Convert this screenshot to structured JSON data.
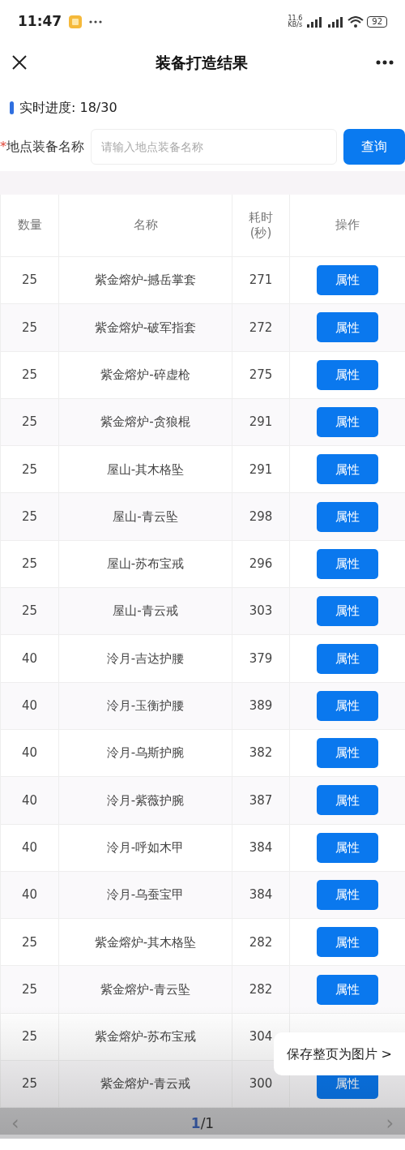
{
  "status_bar": {
    "time": "11:47",
    "speed": "11.6\nKB/s",
    "battery": "92"
  },
  "header": {
    "title": "装备打造结果"
  },
  "progress": {
    "label": "实时进度: 18/30"
  },
  "search": {
    "required_mark": "*",
    "label": "地点装备名称",
    "placeholder": "请输入地点装备名称",
    "button": "查询"
  },
  "table": {
    "columns": [
      "数量",
      "名称",
      "耗时\n(秒)",
      "操作"
    ],
    "rows": [
      {
        "qty": "25",
        "name": "紫金熔炉-撼岳掌套",
        "time": "271",
        "action": "属性"
      },
      {
        "qty": "25",
        "name": "紫金熔炉-破军指套",
        "time": "272",
        "action": "属性"
      },
      {
        "qty": "25",
        "name": "紫金熔炉-碎虚枪",
        "time": "275",
        "action": "属性"
      },
      {
        "qty": "25",
        "name": "紫金熔炉-贪狼棍",
        "time": "291",
        "action": "属性"
      },
      {
        "qty": "25",
        "name": "屋山-其木格坠",
        "time": "291",
        "action": "属性"
      },
      {
        "qty": "25",
        "name": "屋山-青云坠",
        "time": "298",
        "action": "属性"
      },
      {
        "qty": "25",
        "name": "屋山-苏布宝戒",
        "time": "296",
        "action": "属性"
      },
      {
        "qty": "25",
        "name": "屋山-青云戒",
        "time": "303",
        "action": "属性"
      },
      {
        "qty": "40",
        "name": "泠月-吉达护腰",
        "time": "379",
        "action": "属性"
      },
      {
        "qty": "40",
        "name": "泠月-玉衡护腰",
        "time": "389",
        "action": "属性"
      },
      {
        "qty": "40",
        "name": "泠月-乌斯护腕",
        "time": "382",
        "action": "属性"
      },
      {
        "qty": "40",
        "name": "泠月-紫薇护腕",
        "time": "387",
        "action": "属性"
      },
      {
        "qty": "40",
        "name": "泠月-呼如木甲",
        "time": "384",
        "action": "属性"
      },
      {
        "qty": "40",
        "name": "泠月-乌蚕宝甲",
        "time": "384",
        "action": "属性"
      },
      {
        "qty": "25",
        "name": "紫金熔炉-其木格坠",
        "time": "282",
        "action": "属性"
      },
      {
        "qty": "25",
        "name": "紫金熔炉-青云坠",
        "time": "282",
        "action": "属性"
      },
      {
        "qty": "25",
        "name": "紫金熔炉-苏布宝戒",
        "time": "304"
      },
      {
        "qty": "25",
        "name": "紫金熔炉-青云戒",
        "time": "300",
        "action": "属性"
      }
    ]
  },
  "pagination": {
    "prev": "‹",
    "current": "1",
    "total": "/1",
    "next": "›"
  },
  "toast": {
    "text": "保存整页为图片 >"
  }
}
